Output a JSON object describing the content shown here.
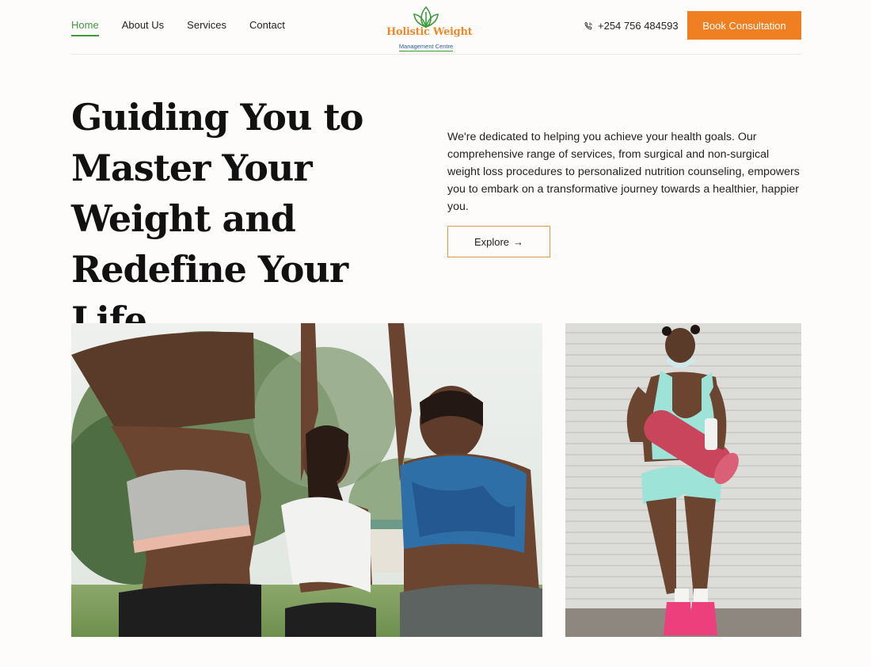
{
  "nav": {
    "items": [
      {
        "label": "Home",
        "active": true
      },
      {
        "label": "About Us",
        "active": false
      },
      {
        "label": "Services",
        "active": false
      },
      {
        "label": "Contact",
        "active": false
      }
    ]
  },
  "logo": {
    "title": "Holistic Weight",
    "subtitle": "Management Centre",
    "title_color": "#e98b2c",
    "subtitle_color": "#2e5da3",
    "leaf_color": "#3f9a3d"
  },
  "header": {
    "phone": "+254 756 484593",
    "phone_icon": "phone-icon",
    "cta_label": "Book Consultation",
    "cta_color": "#f07f22"
  },
  "hero": {
    "title": "Guiding You to Master Your Weight and Redefine Your Life.",
    "body": "We're dedicated to helping you achieve your health goals. Our comprehensive range of services, from surgical and non-surgical weight loss procedures to personalized nutrition counseling, empowers you to embark on a transformative journey towards a healthier, happier you.",
    "button_label": "Explore",
    "button_icon": "arrow-right-icon",
    "button_border_color": "#e09a4d"
  },
  "images": [
    {
      "name": "group-workout-photo"
    },
    {
      "name": "woman-with-yoga-mat-photo"
    }
  ]
}
